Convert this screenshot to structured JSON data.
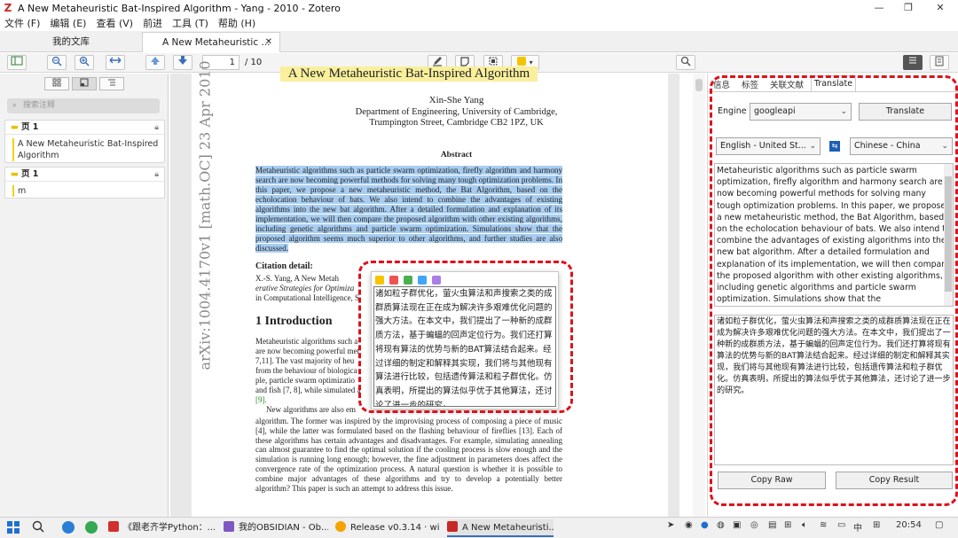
{
  "titlebar": {
    "app_logo": "Z",
    "title": "A New Metaheuristic Bat-Inspired Algorithm - Yang - 2010 - Zotero",
    "minimize": "—",
    "maximize": "❐",
    "close": "✕"
  },
  "menu": {
    "file": "文件 (F)",
    "edit": "编辑 (E)",
    "view": "查看 (V)",
    "go": "前进",
    "tools": "工具 (T)",
    "help": "帮助 (H)"
  },
  "tabs": {
    "library": "我的文库",
    "reader": "A New Metaheuristic ...",
    "close_icon": "✕"
  },
  "toolbar": {
    "page_number": "1",
    "page_total": "/ 10",
    "highlight_color": "#f5c400"
  },
  "left_pane": {
    "search_placeholder": "搜索注释",
    "annotations": [
      {
        "page": "页 1",
        "text": "A New Metaheuristic Bat-Inspired Algorithm"
      },
      {
        "page": "页 1",
        "text": "m"
      }
    ]
  },
  "paper": {
    "arxiv_id": "arXiv:1004.4170v1 [math.OC] 23 Apr 2010",
    "title": "A New Metaheuristic Bat-Inspired Algorithm",
    "author": "Xin-She Yang",
    "affiliation_1": "Department of Engineering, University of Cambridge,",
    "affiliation_2": "Trumpington Street, Cambridge CB2 1PZ, UK",
    "abstract_heading": "Abstract",
    "abstract": "Metaheuristic algorithms such as particle swarm optimization, firefly algorithm and harmony search are now becoming powerful methods for solving many tough optimization problems. In this paper, we propose a new metaheuristic method, the Bat Algorithm, based on the echolocation behaviour of bats. We also intend to combine the advantages of existing algorithms into the new bat algorithm. After a detailed formulation and explanation of its implementation, we will then compare the proposed algorithm with other existing algorithms, including genetic algorithms and particle swarm optimization. Simulations show that the proposed algorithm seems much superior to other algorithms, and further studies are also discussed.",
    "citation_heading": "Citation detail:",
    "citation_line1": "X.-S. Yang, A New Metah",
    "citation_line2": "erative Strategies for Optimiza",
    "citation_line3": "in Computational Intelligence, S",
    "intro_heading": "1   Introduction",
    "intro_lines": [
      "Metaheuristic algorithms such a",
      "are now becoming powerful met",
      "7,11]. The vast majority of heu",
      "from the behaviour of biologica",
      "ple, particle swarm optimizatio",
      "and fish [7, 8], while simulated a",
      "[9]."
    ],
    "para2_start": "New algorithms are also em",
    "para2_body": "algorithm. The former was inspired by the improvising process of composing a piece of music [4], while the latter was formulated based on the flashing behaviour of fireflies [13]. Each of these algorithms has certain advantages and disadvantages. For example, simulating annealing can almost guarantee to find the optimal solution if the cooling process is slow enough and the simulation is running long enough; however, the fine adjustment in parameters does affect the convergence rate of the optimization process. A natural question is whether it is possible to combine major advantages of these algorithms and try to develop a potentially better algorithm? This paper is such an attempt to address this issue."
  },
  "popup": {
    "colors": [
      "#f5c400",
      "#ef5350",
      "#4caf50",
      "#42a5f5",
      "#ab7de6"
    ],
    "translation": "诸如粒子群优化，萤火虫算法和声搜索之类的成群质算法现在正在成为解决许多艰难优化问题的强大方法。在本文中，我们提出了一种新的成群质方法，基于蝙蝠的回声定位行为。我们还打算将现有算法的优势与新的BAT算法结合起来。经过详细的制定和解释其实现，我们将与其他现有算法进行比较，包括遗传算法和粒子群优化。仿真表明，所提出的算法似乎优于其他算法，还讨论了进一步的研究。"
  },
  "right_pane": {
    "tabs": [
      "信息",
      "标签",
      "关联文献",
      "Translate"
    ],
    "engine_label": "Engine",
    "engine_value": "googleapi",
    "translate_button": "Translate",
    "source_lang": "English - United St...",
    "target_lang": "Chinese - China",
    "swap_icon": "⇆",
    "source_text": "Metaheuristic algorithms such as particle swarm optimization, firefly algorithm and harmony search are now becoming powerful methods for solving many tough optimization problems. In this paper, we propose a new metaheuristic method, the Bat Algorithm, based on the echolocation behaviour of bats. We also intend to combine the advantages of existing algorithms into the new bat algorithm. After a detailed formulation and explanation of its implementation, we will then compare the proposed algorithm with other existing algorithms, including genetic algorithms and particle swarm optimization. Simulations show that the",
    "result_text": "诸如粒子群优化，萤火虫算法和声搜索之类的成群质算法现在正在成为解决许多艰难优化问题的强大方法。在本文中，我们提出了一种新的成群质方法，基于蝙蝠的回声定位行为。我们还打算将现有算法的优势与新的BAT算法结合起来。经过详细的制定和解释其实现，我们将与其他现有算法进行比较，包括遗传算法和粒子群优化。仿真表明，所提出的算法似乎优于其他算法，还讨论了进一步的研究。",
    "copy_raw": "Copy Raw",
    "copy_result": "Copy Result"
  },
  "taskbar": {
    "items": [
      "《跟老齐学Python：...",
      "我的OBSIDIAN - Ob...",
      "Release v0.3.14 · wi...",
      "A New Metaheuristi..."
    ],
    "ime": "中",
    "clock": "20:54"
  },
  "accent_color": "#e0101a"
}
